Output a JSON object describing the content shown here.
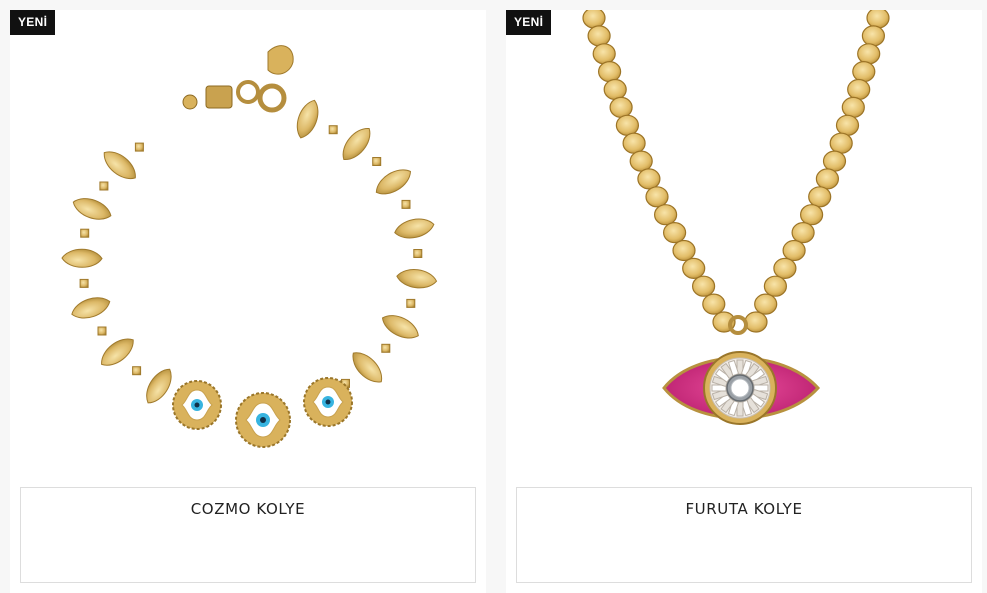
{
  "products": [
    {
      "badge": "YENİ",
      "name": "COZMO KOLYE",
      "image_icon": "gold-bracelet-evil-eye-image"
    },
    {
      "badge": "YENİ",
      "name": "FURUTA KOLYE",
      "image_icon": "gold-necklace-evil-eye-pendant-image"
    }
  ],
  "colors": {
    "badge_bg": "#111111",
    "gold": "#d9b25c",
    "gold_dark": "#a07a2c",
    "pink": "#d62a86",
    "turquoise": "#37b4e0"
  }
}
